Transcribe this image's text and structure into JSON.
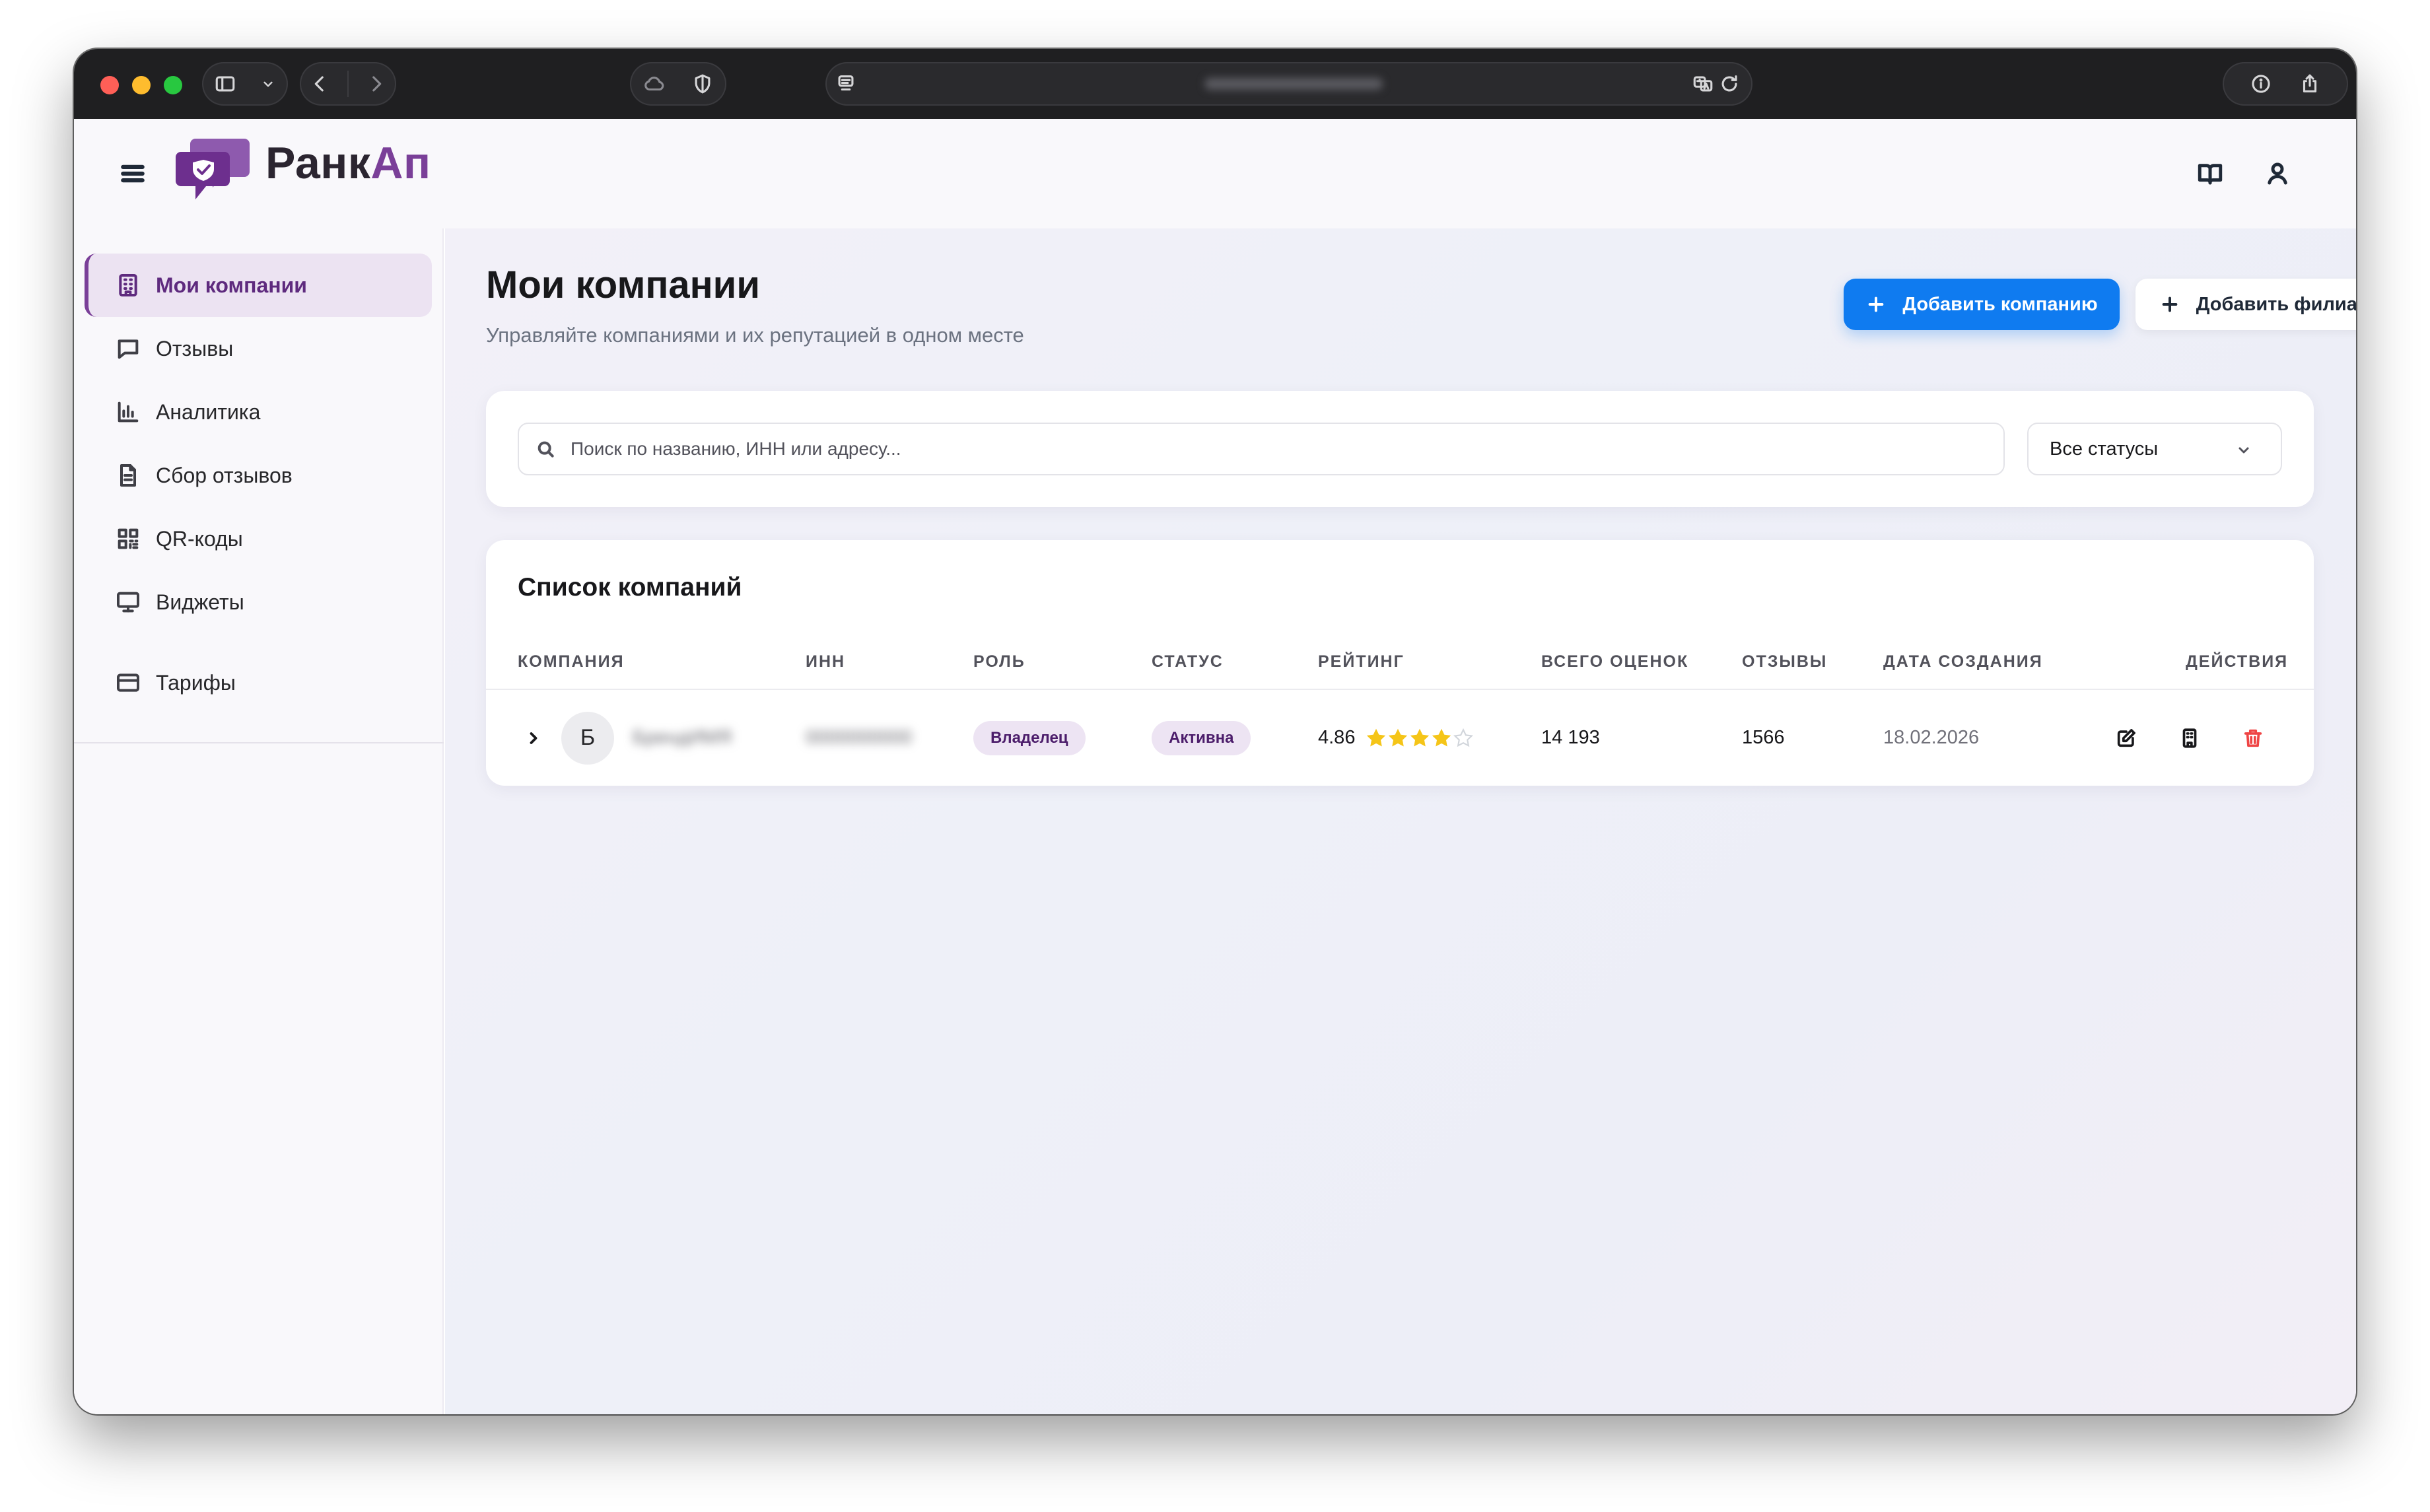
{
  "browser": {
    "icons": [
      "sidebar-icon",
      "chevron-down-icon",
      "back-icon",
      "forward-icon",
      "cloud-icon",
      "shield-icon",
      "reader-icon",
      "translate-icon",
      "reload-icon",
      "info-icon",
      "share-icon",
      "plus-icon",
      "tabs-icon"
    ]
  },
  "brand": {
    "part1": "Ранк",
    "part2": "Ап",
    "accent": "#7a3f98"
  },
  "sidebar": {
    "items": [
      {
        "label": "Мои компании",
        "icon": "building-icon",
        "active": true
      },
      {
        "label": "Отзывы",
        "icon": "message-icon"
      },
      {
        "label": "Аналитика",
        "icon": "bar-chart-icon"
      },
      {
        "label": "Сбор отзывов",
        "icon": "document-icon"
      },
      {
        "label": "QR-коды",
        "icon": "qr-code-icon"
      },
      {
        "label": "Виджеты",
        "icon": "monitor-icon"
      },
      {
        "label": "Тарифы",
        "icon": "credit-card-icon"
      }
    ]
  },
  "header": {
    "title": "Мои компании",
    "subtitle": "Управляйте компаниями и их репутацией в одном месте",
    "add_company": "Добавить компанию",
    "add_branch": "Добавить филиал",
    "primary_color": "#0f7bf0"
  },
  "filters": {
    "search_placeholder": "Поиск по названию, ИНН или адресу...",
    "status_value": "Все статусы"
  },
  "list": {
    "title": "Список компаний",
    "columns": [
      "Компания",
      "ИНН",
      "Роль",
      "Статус",
      "Рейтинг",
      "Всего оценок",
      "Отзывы",
      "Дата создания",
      "Действия"
    ],
    "rows": [
      {
        "initial": "Б",
        "name": "БрендИМЯ",
        "inn": "0000000000",
        "role": "Владелец",
        "status": "Активна",
        "rating": "4.86",
        "rating_value": 4.86,
        "rating_max": 5,
        "total_ratings": "14 193",
        "reviews": "1566",
        "created": "18.02.2026"
      }
    ]
  },
  "colors": {
    "star": "#f5c518",
    "delete": "#ef4444"
  }
}
